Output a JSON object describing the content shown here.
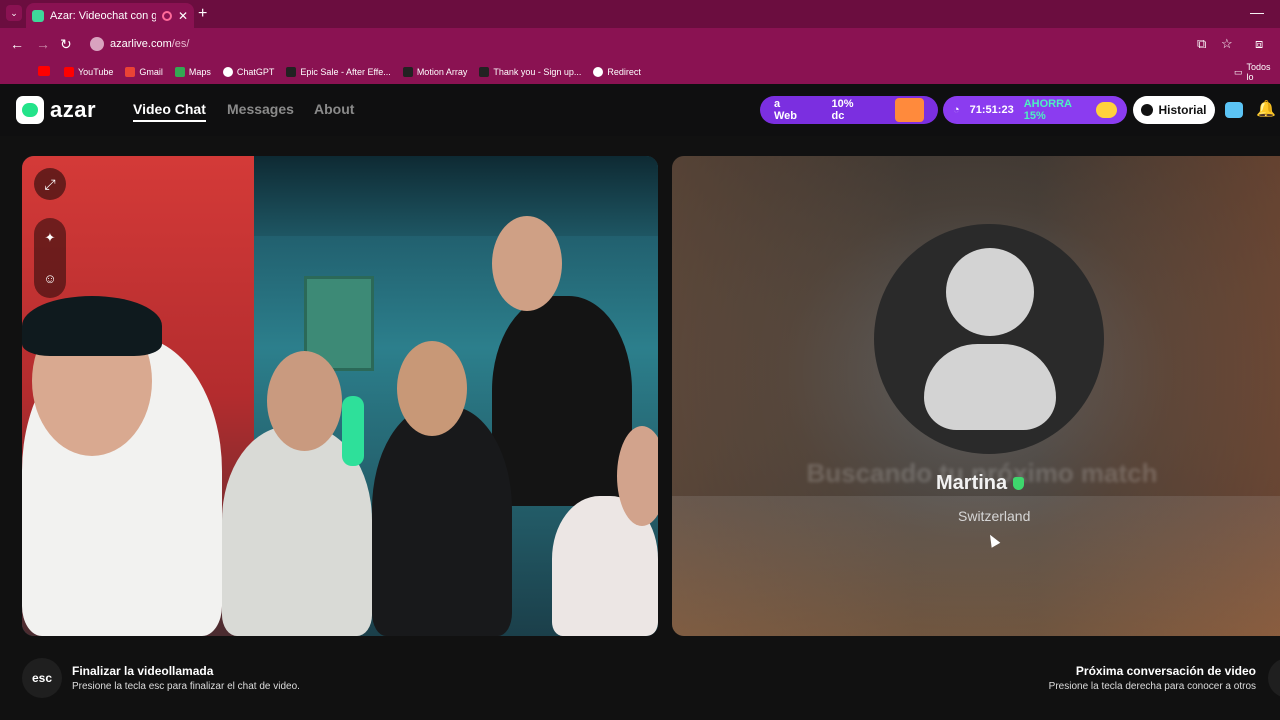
{
  "browser": {
    "tab_title": "Azar: Videochat con gente r",
    "url_host": "azarlive.com",
    "url_path": "/es/",
    "bookmarks": [
      {
        "label": "YouTube",
        "color": "#ff0000"
      },
      {
        "label": "Gmail",
        "color": "#ea4335"
      },
      {
        "label": "Maps",
        "color": "#34a853"
      },
      {
        "label": "ChatGPT",
        "color": "#ffffff"
      },
      {
        "label": "Epic Sale - After Effe...",
        "color": "#222222"
      },
      {
        "label": "Motion Array",
        "color": "#222222"
      },
      {
        "label": "Thank you - Sign up...",
        "color": "#222222"
      },
      {
        "label": "Redirect",
        "color": "#ffffff"
      }
    ],
    "bookmarks_all": "Todos lo"
  },
  "header": {
    "logo_text": "azar",
    "nav": [
      {
        "label": "Video Chat",
        "active": true
      },
      {
        "label": "Messages",
        "active": false
      },
      {
        "label": "About",
        "active": false
      }
    ],
    "promo1_left": "a Web",
    "promo1_right": "10% dc",
    "timer": "71:51:23",
    "promo2": "AHORRA 15%",
    "history_label": "Historial"
  },
  "remote": {
    "searching_text": "Buscando tu próximo match",
    "name": "Martina",
    "country": "Switzerland"
  },
  "footer": {
    "esc_key": "esc",
    "end_title": "Finalizar la videollamada",
    "end_sub": "Presione la tecla esc para finalizar el chat de video.",
    "next_title": "Próxima conversación de video",
    "next_sub": "Presione la tecla derecha para conocer a otros"
  },
  "colors": {
    "browser_frame": "#8a1252",
    "accent_green": "#23e38a",
    "promo_purple": "#7b2fe0"
  }
}
